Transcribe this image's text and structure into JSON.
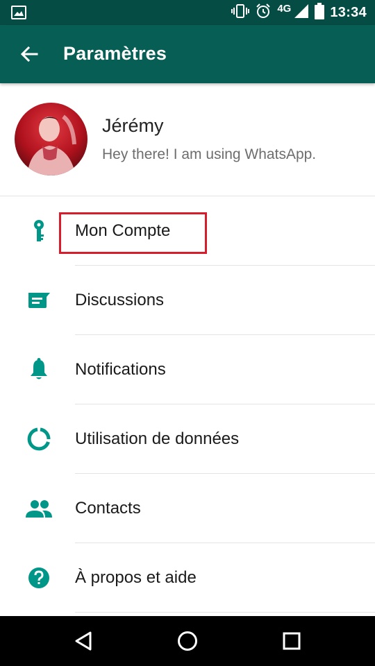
{
  "status_bar": {
    "time": "13:34",
    "network": "4G",
    "icons": [
      "image-icon",
      "vibrate-icon",
      "alarm-icon",
      "signal-icon",
      "battery-icon"
    ]
  },
  "app_bar": {
    "title": "Paramètres",
    "back_icon": "arrow-back-icon"
  },
  "profile": {
    "name": "Jérémy",
    "status": "Hey there! I am using WhatsApp."
  },
  "settings": {
    "items": [
      {
        "label": "Mon Compte",
        "icon": "key-icon"
      },
      {
        "label": "Discussions",
        "icon": "chat-icon"
      },
      {
        "label": "Notifications",
        "icon": "bell-icon"
      },
      {
        "label": "Utilisation de données",
        "icon": "data-usage-icon"
      },
      {
        "label": "Contacts",
        "icon": "contacts-icon"
      },
      {
        "label": "À propos et aide",
        "icon": "help-icon"
      }
    ]
  },
  "nav_bar": {
    "buttons": [
      "back-triangle-icon",
      "home-circle-icon",
      "recents-square-icon"
    ]
  },
  "colors": {
    "status_bar": "#054d44",
    "app_bar": "#075e54",
    "icon_accent": "#009688",
    "highlight": "#d71d2b"
  }
}
